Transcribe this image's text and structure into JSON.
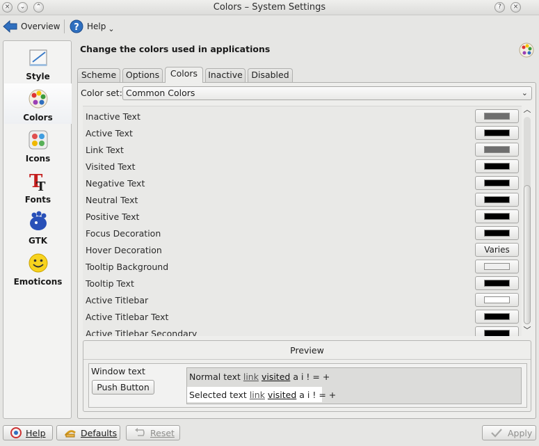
{
  "window": {
    "title": "Colors – System Settings",
    "help_glyph": "?",
    "close_glyph": "×",
    "close_window_glyph": "×",
    "menu_glyph": "⌄",
    "keep_glyph": "⌃"
  },
  "toolbar": {
    "overview_label": "Overview",
    "help_label": "Help",
    "help_dropdown_glyph": "⌄"
  },
  "sidebar": {
    "items": [
      {
        "label": "Style"
      },
      {
        "label": "Colors"
      },
      {
        "label": "Icons"
      },
      {
        "label": "Fonts"
      },
      {
        "label": "GTK"
      },
      {
        "label": "Emoticons"
      }
    ]
  },
  "main": {
    "heading": "Change the colors used in applications",
    "tabs": [
      {
        "label": "Scheme"
      },
      {
        "label": "Options"
      },
      {
        "label": "Colors"
      },
      {
        "label": "Inactive"
      },
      {
        "label": "Disabled"
      }
    ],
    "color_set_label": "Color set:",
    "color_set_value": "Common Colors"
  },
  "color_rows": [
    {
      "name": "Inactive Text",
      "swatch": "#6e6e6e"
    },
    {
      "name": "Active Text",
      "swatch": "#000000"
    },
    {
      "name": "Link Text",
      "swatch": "#6e6e6e"
    },
    {
      "name": "Visited Text",
      "swatch": "#000000"
    },
    {
      "name": "Negative Text",
      "swatch": "#000000"
    },
    {
      "name": "Neutral Text",
      "swatch": "#000000"
    },
    {
      "name": "Positive Text",
      "swatch": "#000000"
    },
    {
      "name": "Focus Decoration",
      "swatch": "#000000"
    },
    {
      "name": "Hover Decoration",
      "text": "Varies"
    },
    {
      "name": "Tooltip Background",
      "swatch": "#efefef"
    },
    {
      "name": "Tooltip Text",
      "swatch": "#000000"
    },
    {
      "name": "Active Titlebar",
      "swatch": "#ffffff"
    },
    {
      "name": "Active Titlebar Text",
      "swatch": "#000000"
    },
    {
      "name": "Active Titlebar Secondary",
      "swatch": "#000000"
    }
  ],
  "scrollbar": {
    "up_glyph": "︿",
    "down_glyph": "﹀",
    "thumb_start_fraction": 0.33,
    "thumb_size_fraction": 0.67
  },
  "preview": {
    "title": "Preview",
    "window_text": "Window text",
    "push_button": "Push Button",
    "normal": {
      "text": "Normal text",
      "link": "link",
      "visited": "visited",
      "rest": "a i ! = +"
    },
    "selected": {
      "text": "Selected text",
      "link": "link",
      "visited": "visited",
      "rest": "a i ! = +"
    }
  },
  "footer": {
    "help_label": "Help",
    "defaults_label": "Defaults",
    "reset_label": "Reset",
    "apply_label": "Apply"
  },
  "colors": {
    "accent": "#2f6fbf",
    "selected_bg": "#ffffff"
  }
}
